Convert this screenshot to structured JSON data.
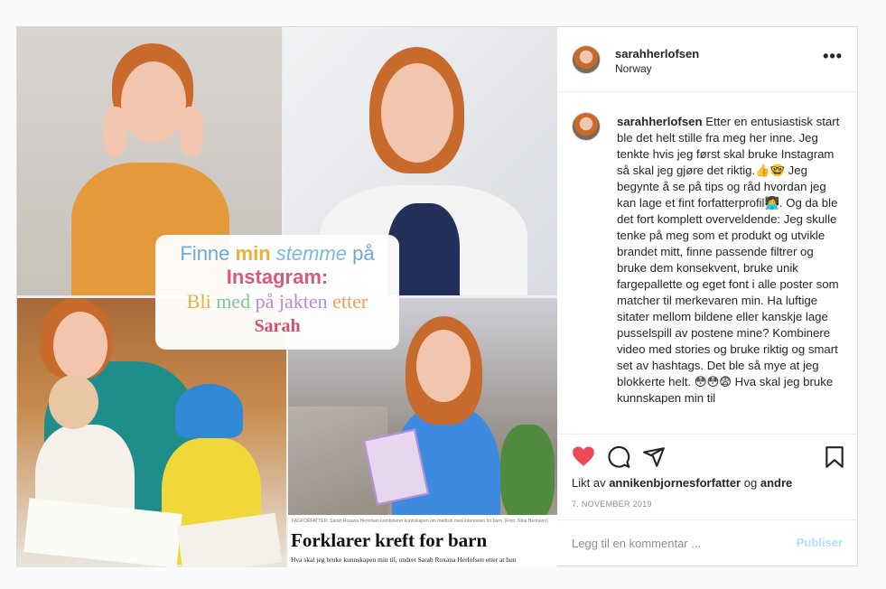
{
  "post": {
    "username": "sarahherlofsen",
    "location": "Norway",
    "more_label": "•••",
    "caption_user": "sarahherlofsen",
    "caption_text": "Etter en entusiastisk start ble det helt stille fra meg her inne. Jeg tenkte hvis jeg først skal bruke Instagram så skal jeg gjøre det riktig.👍🤓 Jeg begynte å se på tips og råd hvordan jeg kan lage et fint forfatterprofil👩‍💻. Og da ble det fort komplett overveldende: Jeg skulle tenke på meg som et produkt og utvikle brandet mitt, finne passende filtrer og bruke dem konsekvent, bruke unik fargepallette og eget font i alle poster som matcher til merkevaren min. Ha luftige sitater mellom bildene eller kanskje lage pusselspill av postene mine? Kombinere video med stories og bruke riktig og smart set av hashtags. Det ble så mye at jeg blokkerte helt. 😳😳😨 Hva skal jeg bruke kunnskapen min til",
    "likes_prefix": "Likt av",
    "likes_user": "annikenbjornesforfatter",
    "likes_and": "og",
    "likes_others": "andre",
    "date": "7. NOVEMBER 2019",
    "comment_placeholder": "Legg til en kommentar ...",
    "publish_label": "Publiser"
  },
  "image": {
    "overlay": {
      "line1_a": "Finne ",
      "line1_b": "min ",
      "line1_c": "stemme",
      "line1_d": " på",
      "line2": "Instagram:",
      "line3_a": "Bli ",
      "line3_b": "med ",
      "line3_c": "på ",
      "line3_d": "jakten ",
      "line3_e": "etter",
      "line4": "Sarah"
    },
    "news_caption": "FAGFORFATTER: Sarah Roxana Herlofsen kombinerer kunnskapen om medisin med interessen for barn. (Foto: Nina Hermann)",
    "headline": "Forklarer kreft for barn",
    "news_sub": "Hva skal jeg bruke kunnskapen min til, undret Sarah Roxana Herlofsen etter at hun"
  },
  "icons": {
    "like": "heart-icon",
    "comment": "comment-icon",
    "share": "paper-plane-icon",
    "save": "bookmark-icon"
  },
  "colors": {
    "like": "#ed4956",
    "publish": "#b2dffc",
    "overlay_blue": "#6fa8d6",
    "overlay_pink": "#d85a80"
  }
}
